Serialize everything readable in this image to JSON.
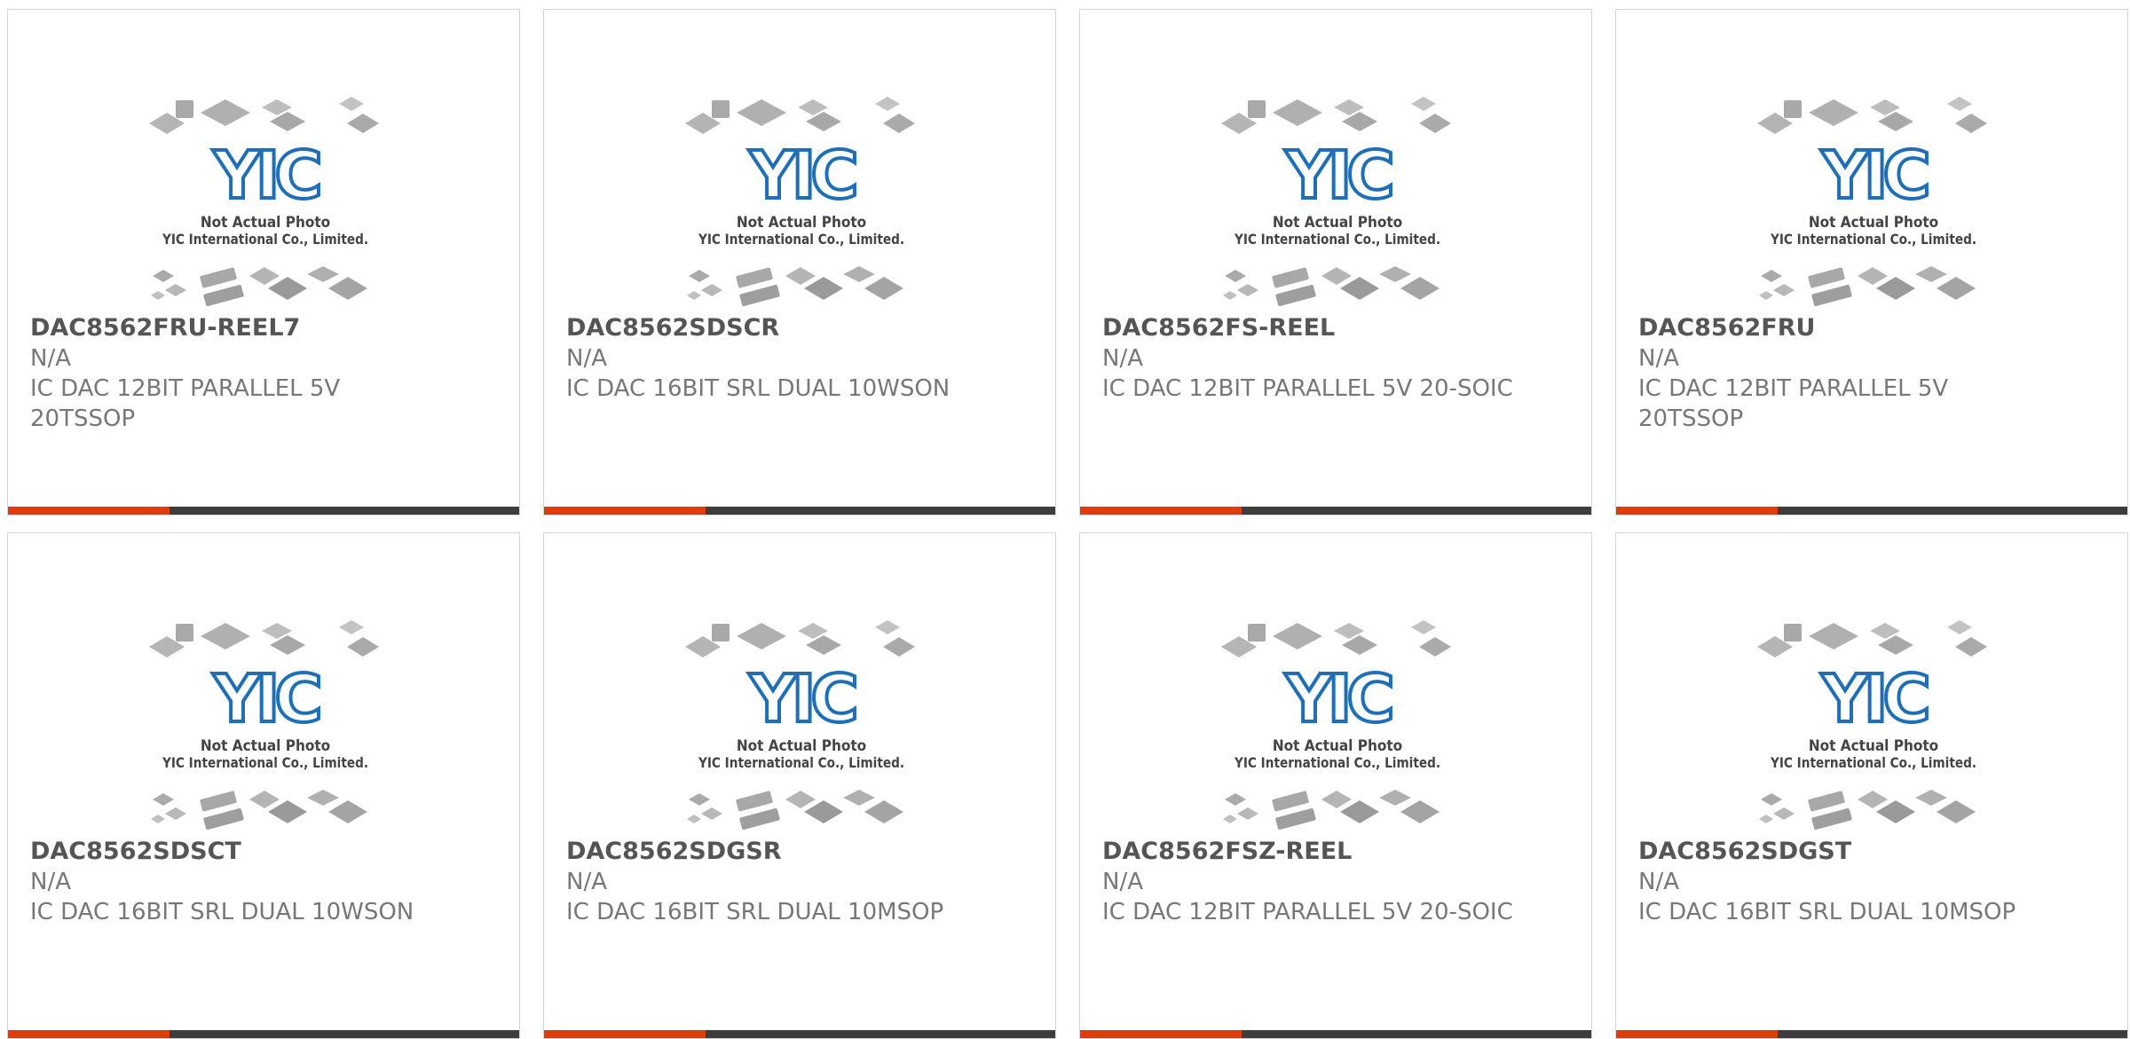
{
  "placeholder": {
    "logo_text": "YIC",
    "line1": "Not Actual Photo",
    "line2": "YIC International Co., Limited."
  },
  "colors": {
    "accent": "#e03c0a",
    "bar": "#3d3d3d",
    "logo_blue": "#1e6fb8"
  },
  "products": [
    {
      "part_number": "DAC8562FRU-REEL7",
      "manufacturer": "N/A",
      "description": "IC DAC 12BIT PARALLEL 5V 20TSSOP"
    },
    {
      "part_number": "DAC8562SDSCR",
      "manufacturer": "N/A",
      "description": "IC DAC 16BIT SRL DUAL 10WSON"
    },
    {
      "part_number": "DAC8562FS-REEL",
      "manufacturer": "N/A",
      "description": "IC DAC 12BIT PARALLEL 5V 20-SOIC"
    },
    {
      "part_number": "DAC8562FRU",
      "manufacturer": "N/A",
      "description": "IC DAC 12BIT PARALLEL 5V 20TSSOP"
    },
    {
      "part_number": "DAC8562SDSCT",
      "manufacturer": "N/A",
      "description": "IC DAC 16BIT SRL DUAL 10WSON"
    },
    {
      "part_number": "DAC8562SDGSR",
      "manufacturer": "N/A",
      "description": "IC DAC 16BIT SRL DUAL 10MSOP"
    },
    {
      "part_number": "DAC8562FSZ-REEL",
      "manufacturer": "N/A",
      "description": "IC DAC 12BIT PARALLEL 5V 20-SOIC"
    },
    {
      "part_number": "DAC8562SDGST",
      "manufacturer": "N/A",
      "description": "IC DAC 16BIT SRL DUAL 10MSOP"
    }
  ]
}
